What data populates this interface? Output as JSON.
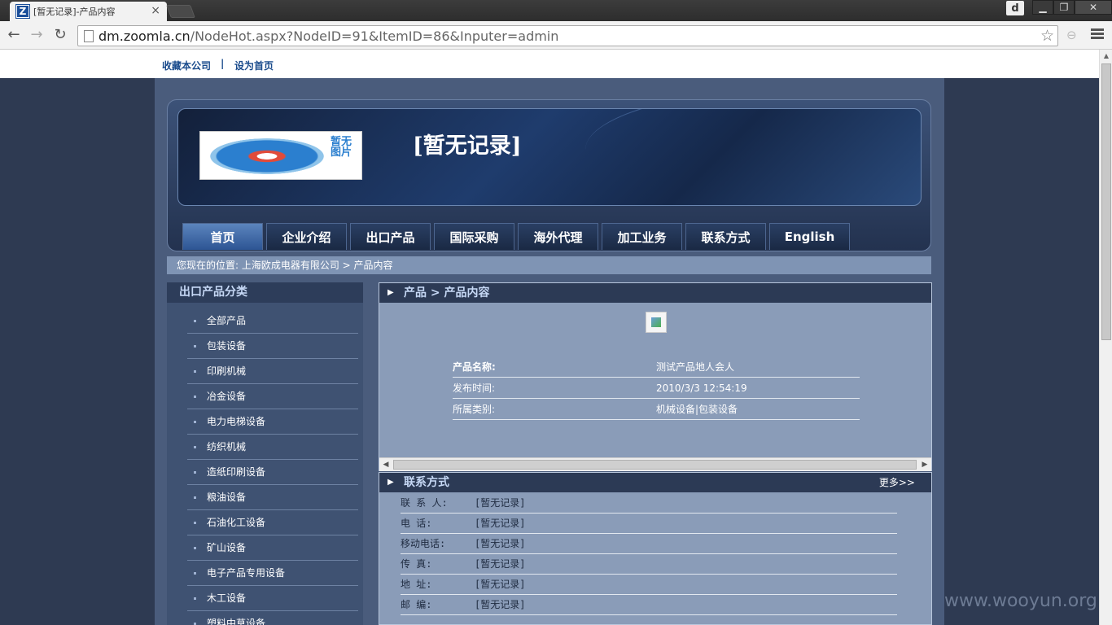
{
  "browser": {
    "tab_title": "[暂无记录]-产品内容",
    "favicon_letter": "Z",
    "url_domain": "dm.zoomla.cn",
    "url_path": "/NodeHot.aspx?NodeID=91&ItemID=86&Inputer=admin",
    "user_badge": "d"
  },
  "toplinks": {
    "bookmark": "收藏本公司",
    "separator": "|",
    "homepage": "设为首页"
  },
  "header": {
    "site_title": "[暂无记录]",
    "logo_text": "暂无图片"
  },
  "nav": [
    {
      "label": "首页"
    },
    {
      "label": "企业介绍"
    },
    {
      "label": "出口产品"
    },
    {
      "label": "国际采购"
    },
    {
      "label": "海外代理"
    },
    {
      "label": "加工业务"
    },
    {
      "label": "联系方式"
    },
    {
      "label": "English"
    }
  ],
  "breadcrumb": "您现在的位置: 上海欧成电器有限公司 > 产品内容",
  "sidebar": {
    "title": "出口产品分类",
    "items": [
      {
        "label": "全部产品"
      },
      {
        "label": "包装设备"
      },
      {
        "label": "印刷机械"
      },
      {
        "label": "冶金设备"
      },
      {
        "label": "电力电梯设备"
      },
      {
        "label": "纺织机械"
      },
      {
        "label": "造纸印刷设备"
      },
      {
        "label": "粮油设备"
      },
      {
        "label": "石油化工设备"
      },
      {
        "label": "矿山设备"
      },
      {
        "label": "电子产品专用设备"
      },
      {
        "label": "木工设备"
      },
      {
        "label": "塑料中草设备"
      }
    ]
  },
  "product": {
    "panel_title": "产品 > 产品内容",
    "rows": [
      {
        "label": "产品名称:",
        "value": "测试产品地人会人"
      },
      {
        "label": "发布时间:",
        "value": "2010/3/3 12:54:19"
      },
      {
        "label": "所属类别:",
        "value": "机械设备|包装设备"
      }
    ]
  },
  "contact": {
    "title": "联系方式",
    "more": "更多>>",
    "rows": [
      {
        "label": "联 系 人:",
        "value": "[暂无记录]"
      },
      {
        "label": "电 话:",
        "value": "[暂无记录]"
      },
      {
        "label": "移动电话:",
        "value": "[暂无记录]"
      },
      {
        "label": "传 真:",
        "value": "[暂无记录]"
      },
      {
        "label": "地 址:",
        "value": "[暂无记录]"
      },
      {
        "label": "邮 编:",
        "value": "[暂无记录]"
      }
    ]
  },
  "watermark": "www.wooyun.org",
  "colors": {
    "page_bg": "#2e3a52",
    "panel_bg": "#8a9cb8",
    "nav_active": "#4a72ad"
  }
}
